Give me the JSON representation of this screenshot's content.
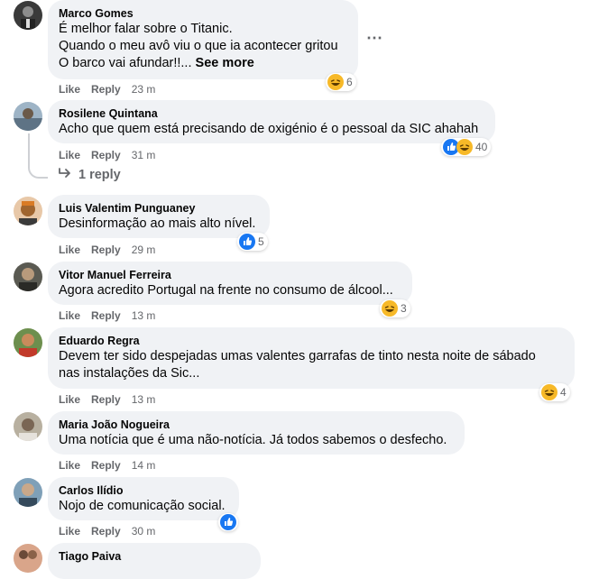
{
  "actions": {
    "like": "Like",
    "reply": "Reply"
  },
  "comments": [
    {
      "author": "Marco Gomes",
      "lines": [
        "É melhor falar sobre o Titanic.",
        "Quando o meu avô viu o que ia acontecer gritou"
      ],
      "last_line": "O barco vai afundar!!...",
      "see_more": "See more",
      "time": "23 m",
      "reaction_count": "6",
      "reaction_icons": [
        "haha-icon"
      ]
    },
    {
      "author": "Rosilene Quintana",
      "lines": [
        "Acho que quem está precisando de oxigénio é o pessoal da SIC ahahah"
      ],
      "time": "31 m",
      "reaction_count": "40",
      "reaction_icons": [
        "like-icon",
        "haha-icon"
      ],
      "replies_label": "1 reply"
    },
    {
      "author": "Luis Valentim Punguaney",
      "lines": [
        "Desinformação ao mais alto nível."
      ],
      "time": "29 m",
      "reaction_count": "5",
      "reaction_icons": [
        "like-icon"
      ]
    },
    {
      "author": "Vitor Manuel Ferreira",
      "lines": [
        "Agora acredito Portugal na frente no consumo de álcool..."
      ],
      "time": "13 m",
      "reaction_count": "3",
      "reaction_icons": [
        "haha-icon"
      ]
    },
    {
      "author": "Eduardo Regra",
      "lines": [
        "Devem ter sido despejadas umas valentes garrafas de tinto nesta noite de sábado",
        "nas instalações da Sic..."
      ],
      "time": "13 m",
      "reaction_count": "4",
      "reaction_icons": [
        "haha-icon"
      ]
    },
    {
      "author": "Maria João Nogueira",
      "lines": [
        "Uma notícia que é uma não-notícia. Já todos sabemos o desfecho."
      ],
      "time": "14 m"
    },
    {
      "author": "Carlos Ilídio",
      "lines": [
        "Nojo de comunicação social."
      ],
      "time": "30 m",
      "reaction_icons": [
        "like-icon"
      ]
    },
    {
      "author": "Tiago Paiva"
    }
  ],
  "colors": {
    "bubble": "#f0f2f5",
    "meta_text": "#65676b",
    "like_blue": "#1877f2",
    "haha_yellow": "#f7b928"
  }
}
